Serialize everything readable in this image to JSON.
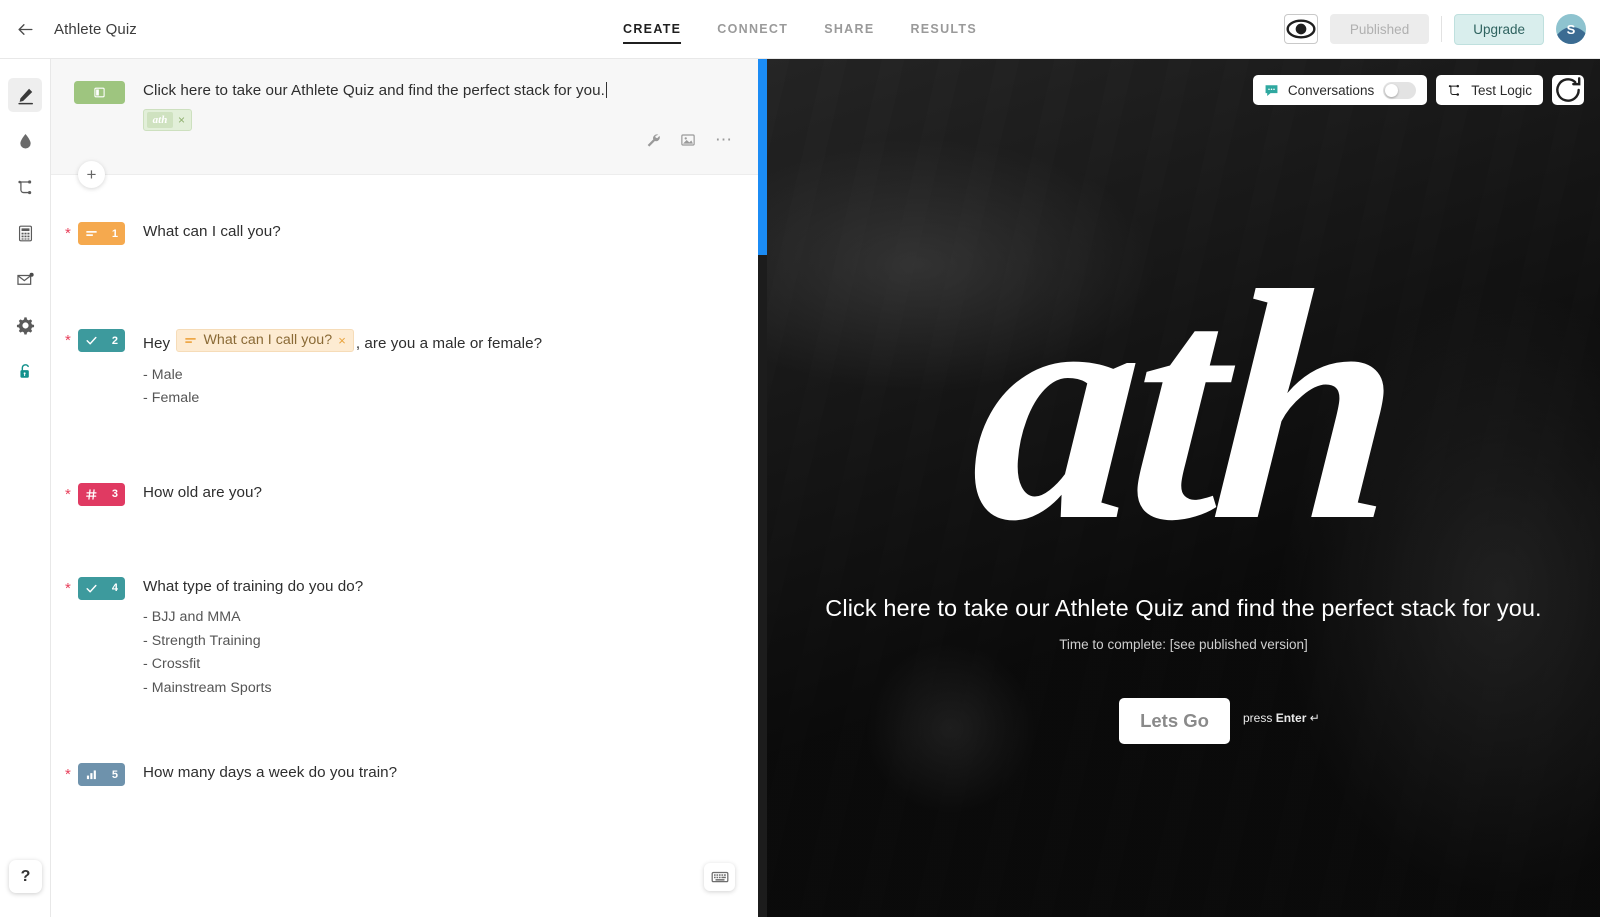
{
  "header": {
    "back_icon": "arrow-left-icon",
    "form_title": "Athlete Quiz",
    "tabs": [
      {
        "label": "CREATE",
        "active": true
      },
      {
        "label": "CONNECT",
        "active": false
      },
      {
        "label": "SHARE",
        "active": false
      },
      {
        "label": "RESULTS",
        "active": false
      }
    ],
    "preview_icon": "eye-icon",
    "published_label": "Published",
    "upgrade_label": "Upgrade",
    "avatar_initial": "S"
  },
  "sidebar": {
    "items": [
      {
        "icon": "pen-edit-icon",
        "name": "create",
        "active": true
      },
      {
        "icon": "droplet-icon",
        "name": "design",
        "active": false
      },
      {
        "icon": "logic-branch-icon",
        "name": "logic",
        "active": false
      },
      {
        "icon": "calculator-icon",
        "name": "calculator",
        "active": false
      },
      {
        "icon": "envelope-notify-icon",
        "name": "notifications",
        "active": false
      },
      {
        "icon": "gear-icon",
        "name": "settings",
        "active": false
      },
      {
        "icon": "lock-icon",
        "name": "privacy",
        "active": false
      }
    ],
    "help_label": "?"
  },
  "editor": {
    "welcome": {
      "badge_icon": "welcome-screen-icon",
      "badge_color": "#9ec57f",
      "text": "Click here to take our Athlete Quiz and find the perfect stack for you.",
      "image_chip": {
        "thumb_text": "ath",
        "remove_label": "×"
      },
      "actions": [
        {
          "icon": "wrench-icon",
          "name": "block-settings"
        },
        {
          "icon": "image-icon",
          "name": "add-image"
        },
        {
          "icon": "ellipsis-icon",
          "name": "more-options"
        }
      ],
      "add_button_label": "+"
    },
    "questions": [
      {
        "number": "1",
        "required": true,
        "type_icon": "short-text-icon",
        "badge_color": "#f5a94e",
        "text": "What can I call you?",
        "choices": []
      },
      {
        "number": "2",
        "required": true,
        "type_icon": "multiple-choice-icon",
        "badge_color": "#3d9a9d",
        "text_before": "Hey ",
        "recall_chip": {
          "icon": "short-text-icon",
          "label": "What can I call you?",
          "remove_label": "×"
        },
        "text_after": ", are you a male or female?",
        "choices": [
          "- Male",
          "- Female"
        ]
      },
      {
        "number": "3",
        "required": true,
        "type_icon": "number-hash-icon",
        "badge_color": "#e03a62",
        "text": "How old are you?",
        "choices": []
      },
      {
        "number": "4",
        "required": true,
        "type_icon": "multiple-choice-icon",
        "badge_color": "#3d9a9d",
        "text": "What type of training do you do?",
        "choices": [
          "- BJJ and MMA",
          "- Strength Training",
          "- Crossfit",
          "- Mainstream Sports"
        ]
      },
      {
        "number": "5",
        "required": true,
        "type_icon": "opinion-scale-icon",
        "badge_color": "#6e92ac",
        "text": "How many days a week do you train?",
        "choices": []
      }
    ],
    "keyboard_icon": "keyboard-icon"
  },
  "preview": {
    "toolbar": {
      "conversations_icon": "speech-bubble-icon",
      "conversations_label": "Conversations",
      "conversations_on": false,
      "test_logic_icon": "logic-branch-icon",
      "test_logic_label": "Test Logic",
      "refresh_icon": "refresh-icon"
    },
    "logo_text": "ath",
    "headline": "Click here to take our Athlete Quiz and find the perfect stack for you.",
    "subtext": "Time to complete: [see published version]",
    "cta_label": "Lets Go",
    "enter_hint_prefix": "press ",
    "enter_hint_key": "Enter",
    "enter_hint_arrow": "↵"
  },
  "scrollbar": {
    "accent_color": "#1b8cf5"
  }
}
